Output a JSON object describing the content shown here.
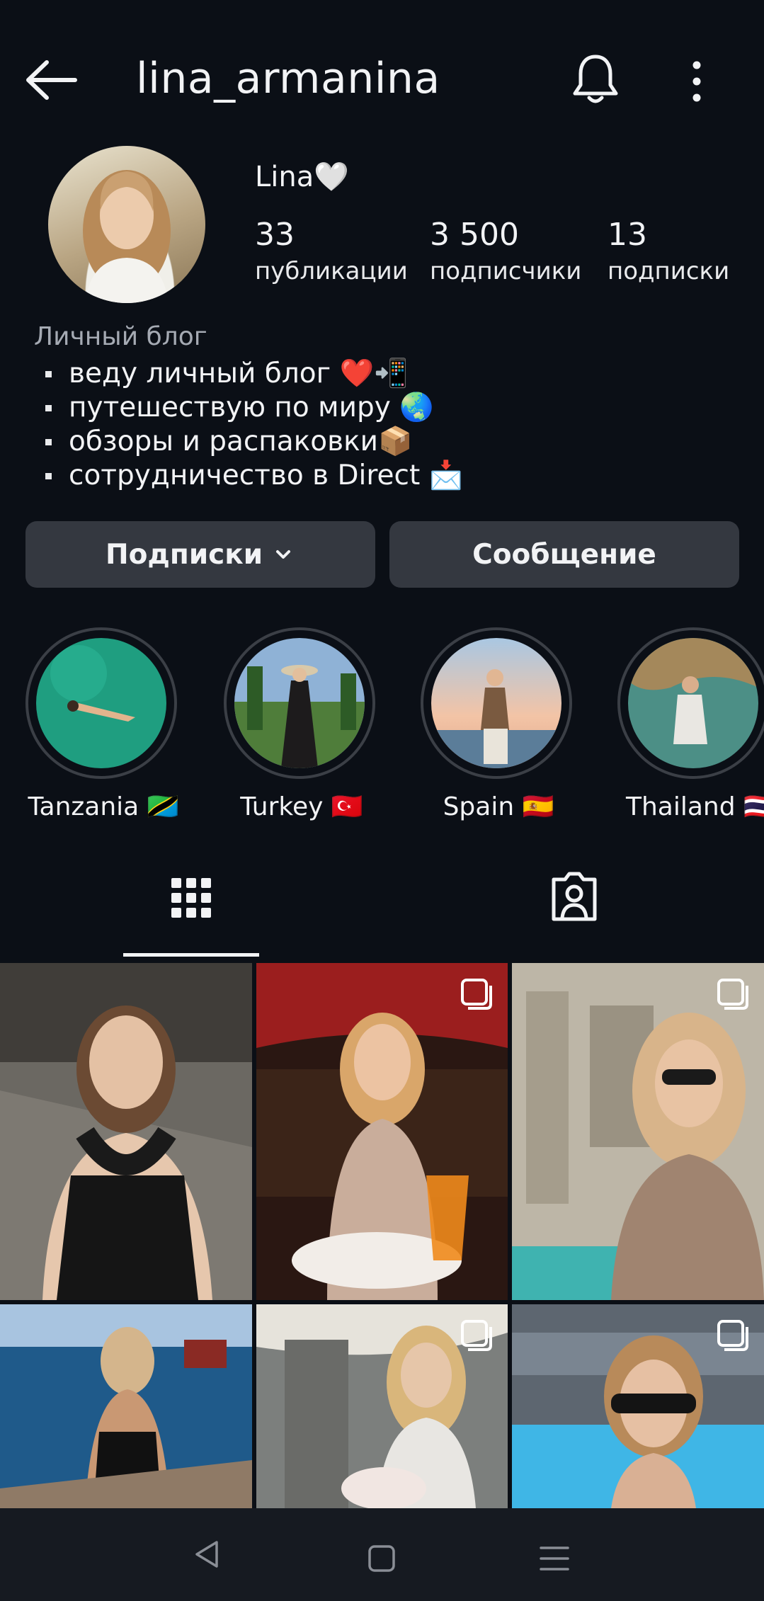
{
  "header": {
    "username": "lina_armanina",
    "back_icon": "arrow-left-icon",
    "bell_icon": "bell-icon",
    "more_icon": "more-vertical-icon"
  },
  "profile": {
    "display_name": "Lina🤍",
    "stats": [
      {
        "value": "33",
        "label": "публикации"
      },
      {
        "value": "3 500",
        "label": "подписчики"
      },
      {
        "value": "13",
        "label": "подписки"
      }
    ],
    "category": "Личный блог",
    "bio": [
      "веду личный блог ❤️📲",
      "путешествую по миру 🌏",
      "обзоры и распаковки📦",
      "сотрудничество в Direct 📩"
    ]
  },
  "actions": {
    "following_label": "Подписки",
    "message_label": "Сообщение"
  },
  "highlights": [
    {
      "label": "Tanzania 🇹🇿"
    },
    {
      "label": "Turkey 🇹🇷"
    },
    {
      "label": "Spain 🇪🇸"
    },
    {
      "label": "Thailand 🇹🇭"
    }
  ],
  "tabs": {
    "grid_icon": "grid-icon",
    "tagged_icon": "tagged-person-icon"
  },
  "colors": {
    "background": "#0b0f16",
    "button": "#343840",
    "text": "#f2f3f5",
    "muted": "#a5aab3"
  }
}
